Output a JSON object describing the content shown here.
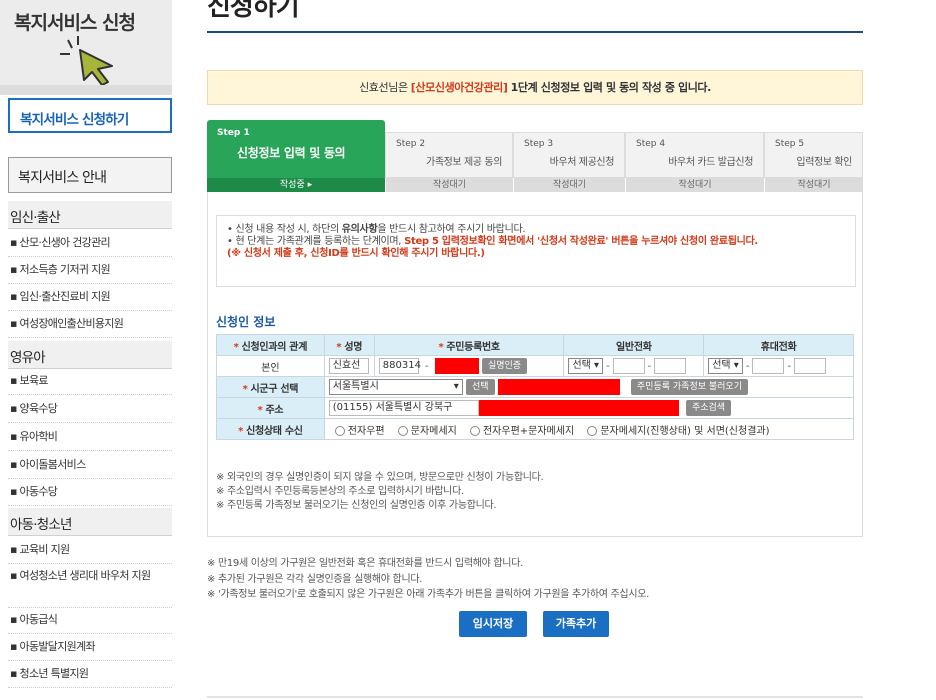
{
  "sidebar": {
    "title": "복지서비스 신청",
    "active_item": "복지서비스 신청하기",
    "section": "복지서비스 안내",
    "cats": [
      {
        "label": "임신·출산",
        "items": [
          "▪ 산모·신생아 건강관리",
          "▪ 저소득층 기저귀 지원",
          "▪ 임신·출산진료비 지원",
          "▪ 여성장애인출산비용지원"
        ]
      },
      {
        "label": "영유아",
        "items": [
          "▪ 보육료",
          "▪ 양육수당",
          "▪ 유아학비",
          "▪ 아이돌봄서비스",
          "▪ 아동수당"
        ]
      },
      {
        "label": "아동·청소년",
        "items": [
          "▪ 교육비 지원",
          "▪ 여성청소년 생리대 바우처 지원",
          "▪ 아동급식",
          "▪ 아동발달지원계좌",
          "▪ 청소년 특별지원"
        ]
      }
    ]
  },
  "header": {
    "title": "신청하기"
  },
  "notice": {
    "name": "신효선님은",
    "program": "[산모신생아건강관리]",
    "rest": "1단계 신청정보 입력 및 동의 작성 중 입니다."
  },
  "steps": [
    {
      "num": "Step 1",
      "label": "신청정보 입력 및 동의",
      "state": "작성중 ▸"
    },
    {
      "num": "Step 2",
      "label": "가족정보 제공 동의",
      "state": "작성대기"
    },
    {
      "num": "Step 3",
      "label": "바우처 제공신청",
      "state": "작성대기"
    },
    {
      "num": "Step 4",
      "label": "바우처 카드 발급신청",
      "state": "작성대기"
    },
    {
      "num": "Step 5",
      "label": "입력정보 확인",
      "state": "작성대기"
    }
  ],
  "guide": {
    "line1_a": "• 신청 내용 작성 시, 하단의 ",
    "line1_b": "유의사항",
    "line1_c": "을 반드시 참고하여 주시기 바랍니다.",
    "line2_a": "• 현 단계는 가족관계를 등록하는 단계이며, ",
    "line2_b": "Step 5 입력정보확인 화면에서 '신청서 작성완료' 버튼을 누르셔야 신청이 완료됩니다.",
    "line3": "(※ 신청서 제출 후, 신청ID를 반드시 확인해 주시기 바랍니다.)"
  },
  "applicant": {
    "section_title": "신청인 정보",
    "headers": [
      "신청인과의 관계",
      "성명",
      "주민등록번호",
      "일반전화",
      "휴대전화"
    ],
    "relation": "본인",
    "name": "신효선",
    "rrn_front": "880314",
    "rrn_dash": "-",
    "verify_btn": "실명인증",
    "select_label": "선택 ▾",
    "sigungu_label": "시군구 선택",
    "sigungu_value": "서울특별시",
    "sigungu_btn": "선택",
    "family_btn": "주민등록 가족정보 불러오기",
    "address_label": "주소",
    "address_value": "(01155) 서울특별시 강북구",
    "address_btn": "주소검색",
    "receive_label": "신청상태 수신",
    "receive_options": [
      "전자우편",
      "문자메세지",
      "전자우편+문자메세지",
      "문자메세지(진행상태) 및 서면(신청결과)"
    ]
  },
  "notes_inner": [
    "※ 외국인의 경우 실명인증이 되지 않을 수 있으며, 방문으로만 신청이 가능합니다.",
    "※ 주소입력시 주민등록등본상의 주소로 입력하시기 바랍니다.",
    "※ 주민등록 가족정보 불러오기는 신청인의 실명인증 이후 가능합니다."
  ],
  "notes_outer": [
    "※ 만19세 이상의 가구원은 일반전화 혹은 휴대전화를 반드시 입력해야 합니다.",
    "※ 추가된 가구원은 각각 실명인증을 실행해야 합니다.",
    "※ '가족정보 불러오기'로 호출되지 않은 가구원은 아래 가족추가 버튼을 클릭하여 가구원을 추가하여 주십시오."
  ],
  "buttons": {
    "temp_save": "임시저장",
    "add_family": "가족추가"
  },
  "colors": {
    "accent_blue": "#1b6fc2",
    "step_green": "#29a55a",
    "highlight_red": "#d03a1a",
    "notice_bg": "#fff6da"
  }
}
